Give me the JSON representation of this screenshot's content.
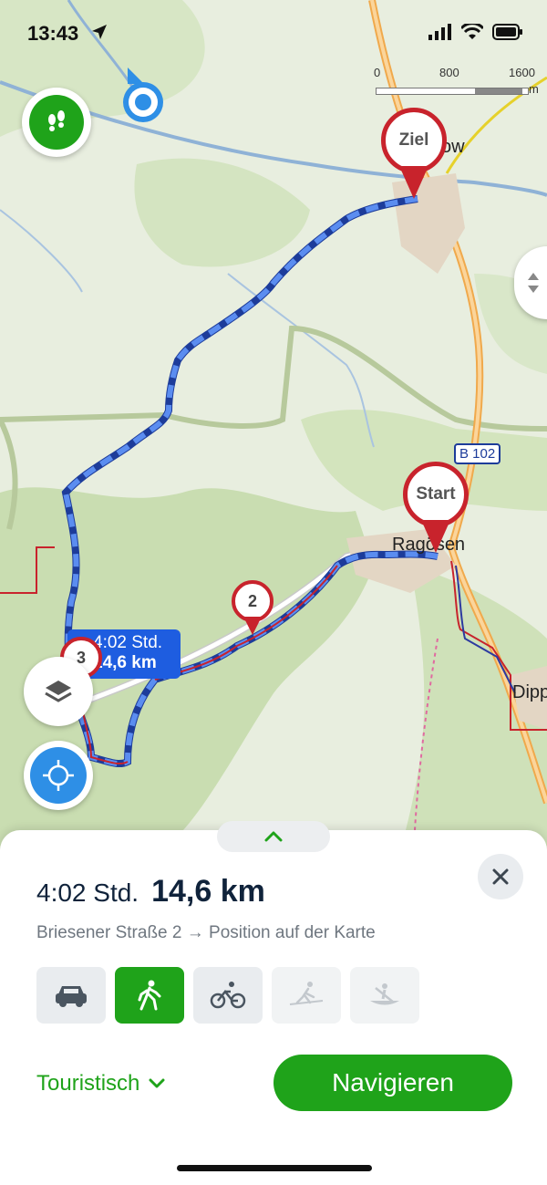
{
  "status": {
    "time": "13:43",
    "icons": [
      "location-arrow-icon",
      "signal-icon",
      "wifi-icon",
      "battery-icon"
    ]
  },
  "map": {
    "scale": {
      "ticks": [
        "0",
        "800",
        "1600"
      ],
      "unit": "m"
    },
    "places": [
      {
        "id": "ziel-town",
        "text": "ow"
      },
      {
        "id": "start-town",
        "text": "Ragösen"
      },
      {
        "id": "dipp",
        "text": "Dipp"
      },
      {
        "id": "road",
        "text": "B 102"
      }
    ],
    "markers": {
      "destination": "Ziel",
      "start": "Start",
      "waypoint_2": "2",
      "waypoint_3": "3"
    },
    "route_label": {
      "time": "4:02 Std.",
      "distance": "14,6 km"
    },
    "colors": {
      "route": "#3a72e6",
      "marker": "#c8232c",
      "accent": "#1fa31a"
    }
  },
  "sheet": {
    "summary_time": "4:02 Std.",
    "summary_distance": "14,6 km",
    "route_description": "Briesener Straße 2 → Position auf der Karte",
    "modes": [
      {
        "name": "car",
        "icon": "car-icon",
        "state": "normal"
      },
      {
        "name": "walk",
        "icon": "walking-icon",
        "state": "active"
      },
      {
        "name": "bike",
        "icon": "bicycle-icon",
        "state": "normal"
      },
      {
        "name": "ski",
        "icon": "ski-icon",
        "state": "disabled"
      },
      {
        "name": "canoe",
        "icon": "canoe-icon",
        "state": "disabled"
      }
    ],
    "profile": "Touristisch",
    "navigate_label": "Navigieren"
  }
}
